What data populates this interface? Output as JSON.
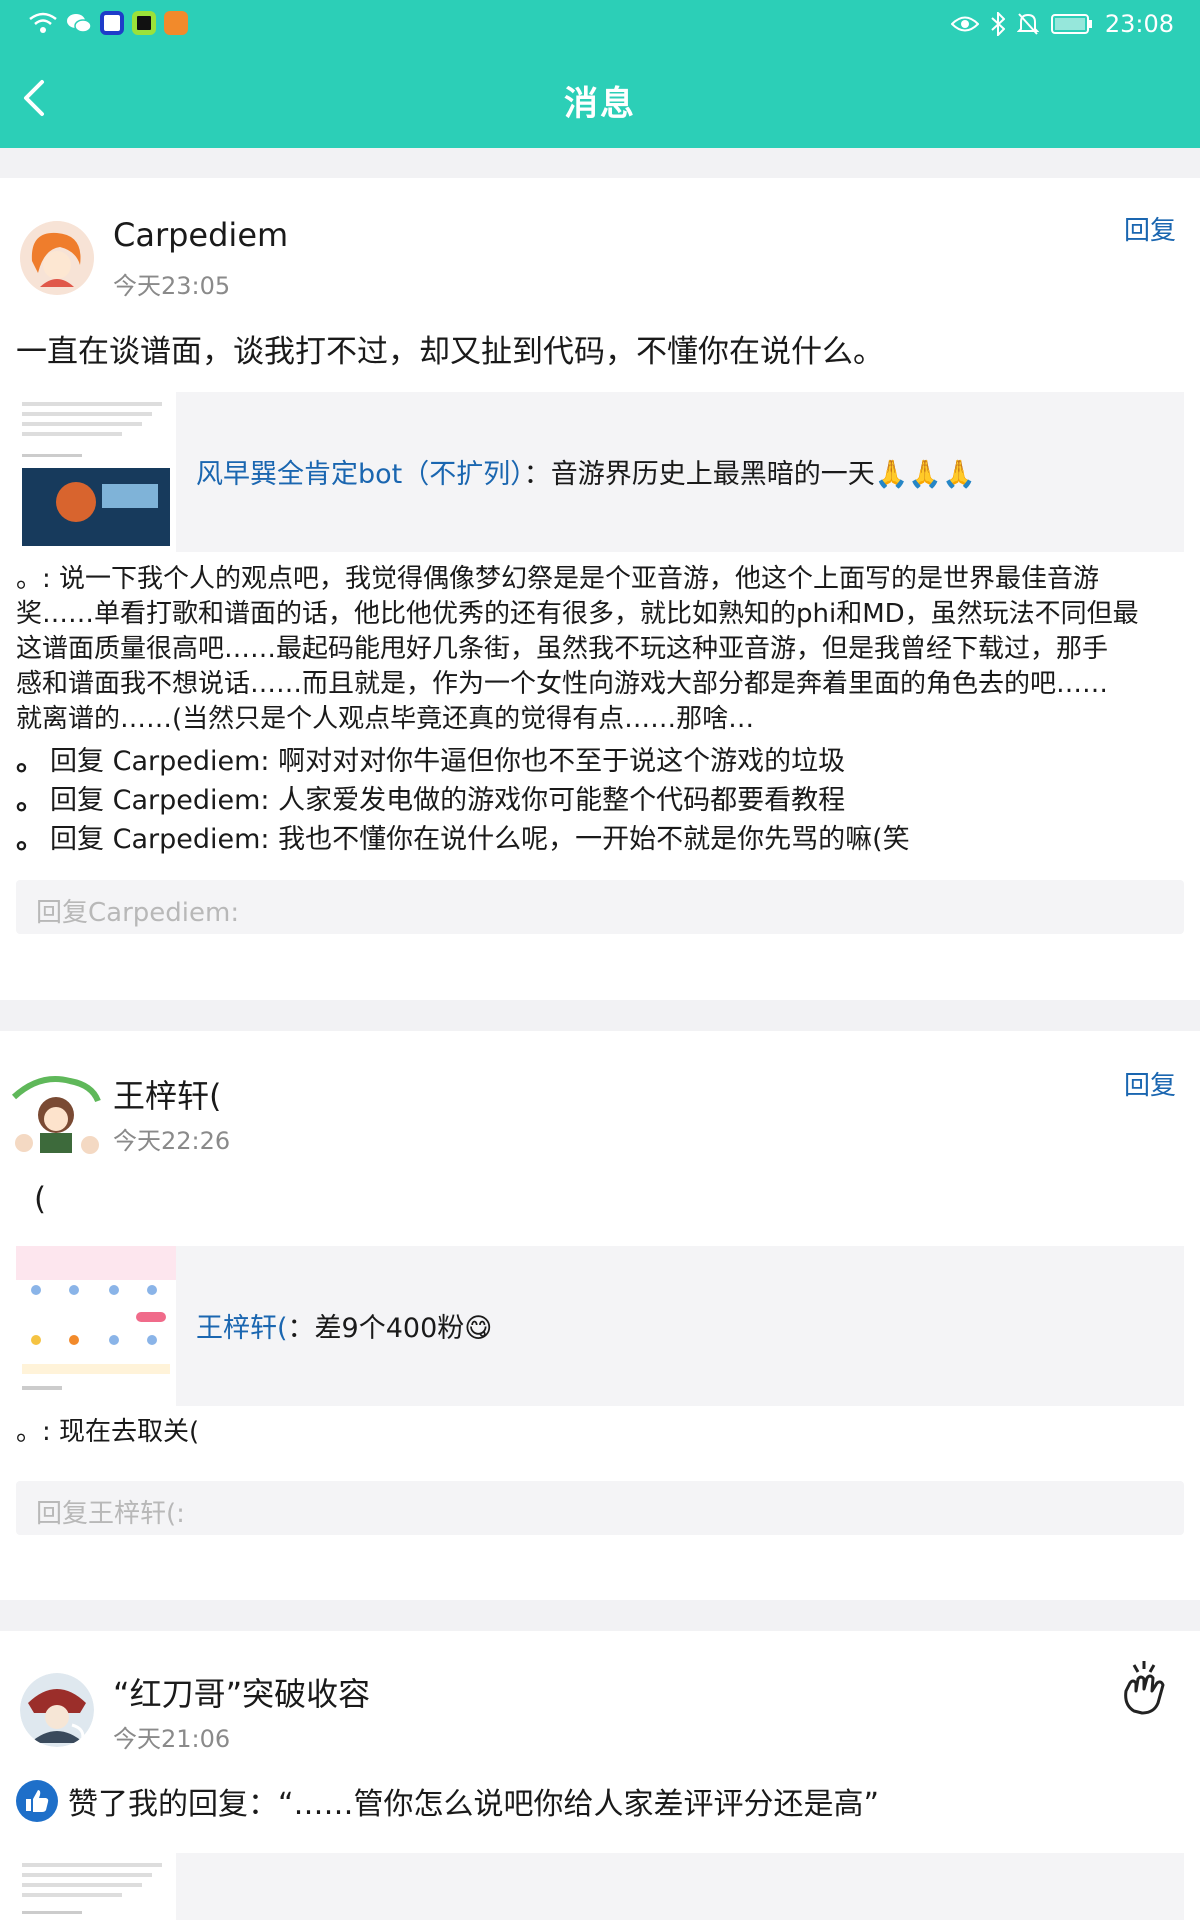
{
  "status": {
    "time": "23:08"
  },
  "header": {
    "title": "消息"
  },
  "messages": [
    {
      "username": "Carpediem",
      "time": "今天23:05",
      "action_label": "回复",
      "text": "一直在谈谱面，谈我打不过，却又扯到代码，不懂你在说什么。",
      "quote": {
        "author": "风早巽全肯定bot（不扩列）",
        "separator": "：",
        "content": "音游界历史上最黑暗的一天🙏🙏🙏"
      },
      "body_lines": [
        "。: 说一下我个人的观点吧，我觉得偶像梦幻祭是是个亚音游，他这个上面写的是世界最佳音游",
        "奖……单看打歌和谱面的话，他比他优秀的还有很多，就比如熟知的phi和MD，虽然玩法不同但最",
        "这谱面质量很高吧……最起码能甩好几条街，虽然我不玩这种亚音游，但是我曾经下载过，那手",
        "感和谱面我不想说话……而且就是，作为一个女性向游戏大部分都是奔着里面的角色去的吧……",
        "就离谱的……(当然只是个人观点毕竟还真的觉得有点……那啥…"
      ],
      "replies": [
        {
          "prefix": "回复",
          "name": "Carpediem",
          "text": ": 啊对对对你牛逼但你也不至于说这个游戏的垃圾"
        },
        {
          "prefix": "回复",
          "name": "Carpediem",
          "text": ": 人家爱发电做的游戏你可能整个代码都要看教程"
        },
        {
          "prefix": "回复",
          "name": "Carpediem",
          "text": ": 我也不懂你在说什么呢，一开始不就是你先骂的嘛(笑"
        }
      ],
      "reply_placeholder": "回复Carpediem:"
    },
    {
      "username": "王梓轩(",
      "time": "今天22:26",
      "action_label": "回复",
      "text": "(",
      "quote": {
        "author": "王梓轩(",
        "separator": "：",
        "content": "差9个400粉😋"
      },
      "body_lines": [
        "。: 现在去取关("
      ],
      "reply_placeholder": "回复王梓轩(:"
    },
    {
      "username": "“红刀哥”突破收容",
      "time": "今天21:06",
      "like_text": "赞了我的回复：“……管你怎么说吧你给人家差评评分还是高”"
    }
  ],
  "colors": {
    "accent": "#2ccfb7",
    "link": "#1a66b0",
    "like": "#1e6fc9"
  },
  "icons": [
    "wifi-icon",
    "wechat-icon",
    "eye-icon",
    "bluetooth-icon",
    "mute-icon",
    "battery-icon",
    "back-arrow-icon",
    "thumbs-up-icon",
    "wave-hand-icon"
  ]
}
